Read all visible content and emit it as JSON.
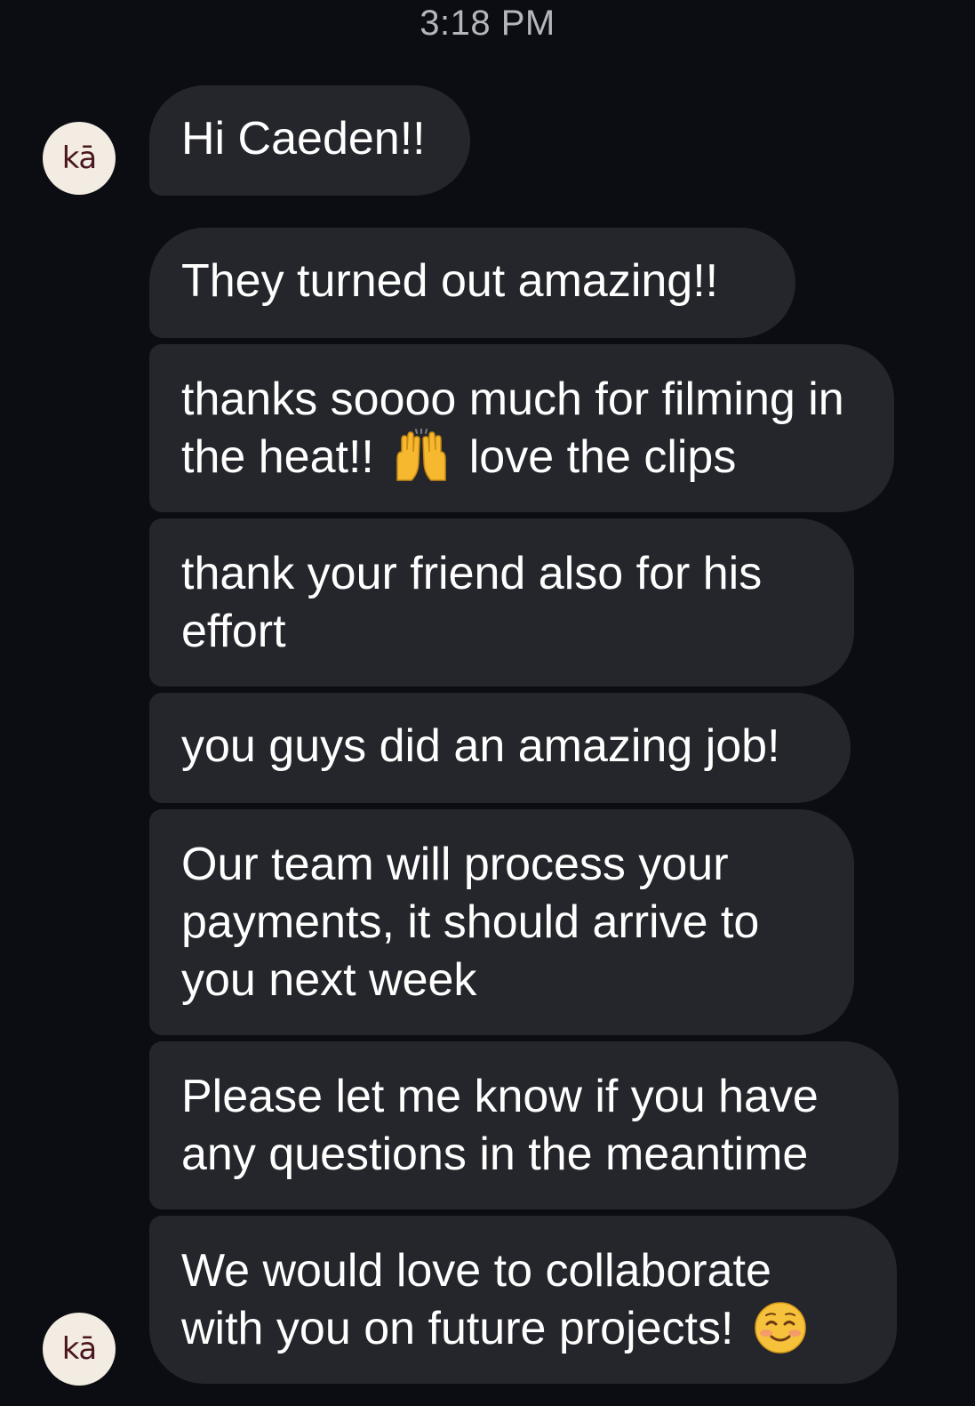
{
  "conversation": {
    "timestamp": "3:18 PM",
    "avatar_label": "kā",
    "messages": [
      {
        "parts": [
          "Hi Caeden!!"
        ]
      },
      {
        "parts": [
          "They turned out amazing!!"
        ]
      },
      {
        "parts": [
          "thanks soooo much for filming in the heat!!",
          "love the clips"
        ],
        "emoji": "raising-hands-emoji"
      },
      {
        "parts": [
          "thank your friend also for his effort"
        ]
      },
      {
        "parts": [
          "you guys did an amazing job!"
        ]
      },
      {
        "parts": [
          "Our team will process your payments, it should arrive to you next week"
        ]
      },
      {
        "parts": [
          "Please let me know if you have any questions in the meantime"
        ]
      },
      {
        "parts": [
          "We would love to collaborate with you on future projects!"
        ],
        "emoji": "smiling-face-emoji"
      }
    ]
  },
  "colors": {
    "background": "#0b0d12",
    "bubble": "#24262b",
    "avatar_bg": "#f3ece2",
    "avatar_text": "#4a1620",
    "timestamp_text": "#b4b6bd"
  }
}
